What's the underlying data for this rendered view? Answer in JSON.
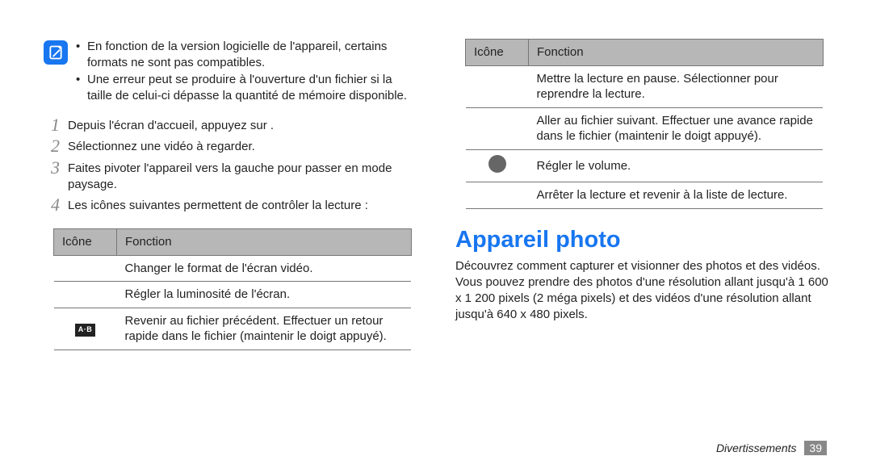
{
  "left": {
    "note_items": [
      "En fonction de la version logicielle de l'appareil, certains formats ne sont pas compatibles.",
      "Une erreur peut se produire à l'ouverture d'un fichier si la taille de celui-ci dépasse la quantité de mémoire disponible."
    ],
    "steps": [
      "Depuis l'écran d'accueil, appuyez sur      .",
      "Sélectionnez une vidéo à regarder.",
      "Faites pivoter l'appareil vers la gauche pour passer en mode paysage.",
      "Les icônes suivantes permettent de contrôler la lecture :"
    ],
    "table": {
      "headers": [
        "Icône",
        "Fonction"
      ],
      "rows": [
        {
          "icon": "",
          "fn": "Changer le format de l'écran vidéo."
        },
        {
          "icon": "",
          "fn": "Régler la luminosité de l'écran."
        },
        {
          "icon": "ab",
          "fn": "Revenir au fichier précédent. Effectuer un retour rapide dans le fichier (maintenir le doigt appuyé)."
        }
      ]
    }
  },
  "right": {
    "table": {
      "headers": [
        "Icône",
        "Fonction"
      ],
      "rows": [
        {
          "icon": "",
          "fn": "Mettre la lecture en pause. Sélectionner      pour reprendre la lecture."
        },
        {
          "icon": "",
          "fn": "Aller au fichier suivant. Effectuer une avance rapide dans le fichier (maintenir le doigt appuyé)."
        },
        {
          "icon": "vol",
          "fn": "Régler le volume."
        },
        {
          "icon": "",
          "fn": "Arrêter la lecture et revenir à la liste de lecture."
        }
      ]
    },
    "heading": "Appareil photo",
    "body": "Découvrez comment capturer et visionner des photos et des vidéos. Vous pouvez prendre des photos d'une résolution allant jusqu'à 1 600 x 1 200 pixels (2 méga pixels) et des vidéos d'une résolution allant jusqu'à 640 x 480 pixels."
  },
  "footer": {
    "section": "Divertissements",
    "page": "39"
  }
}
